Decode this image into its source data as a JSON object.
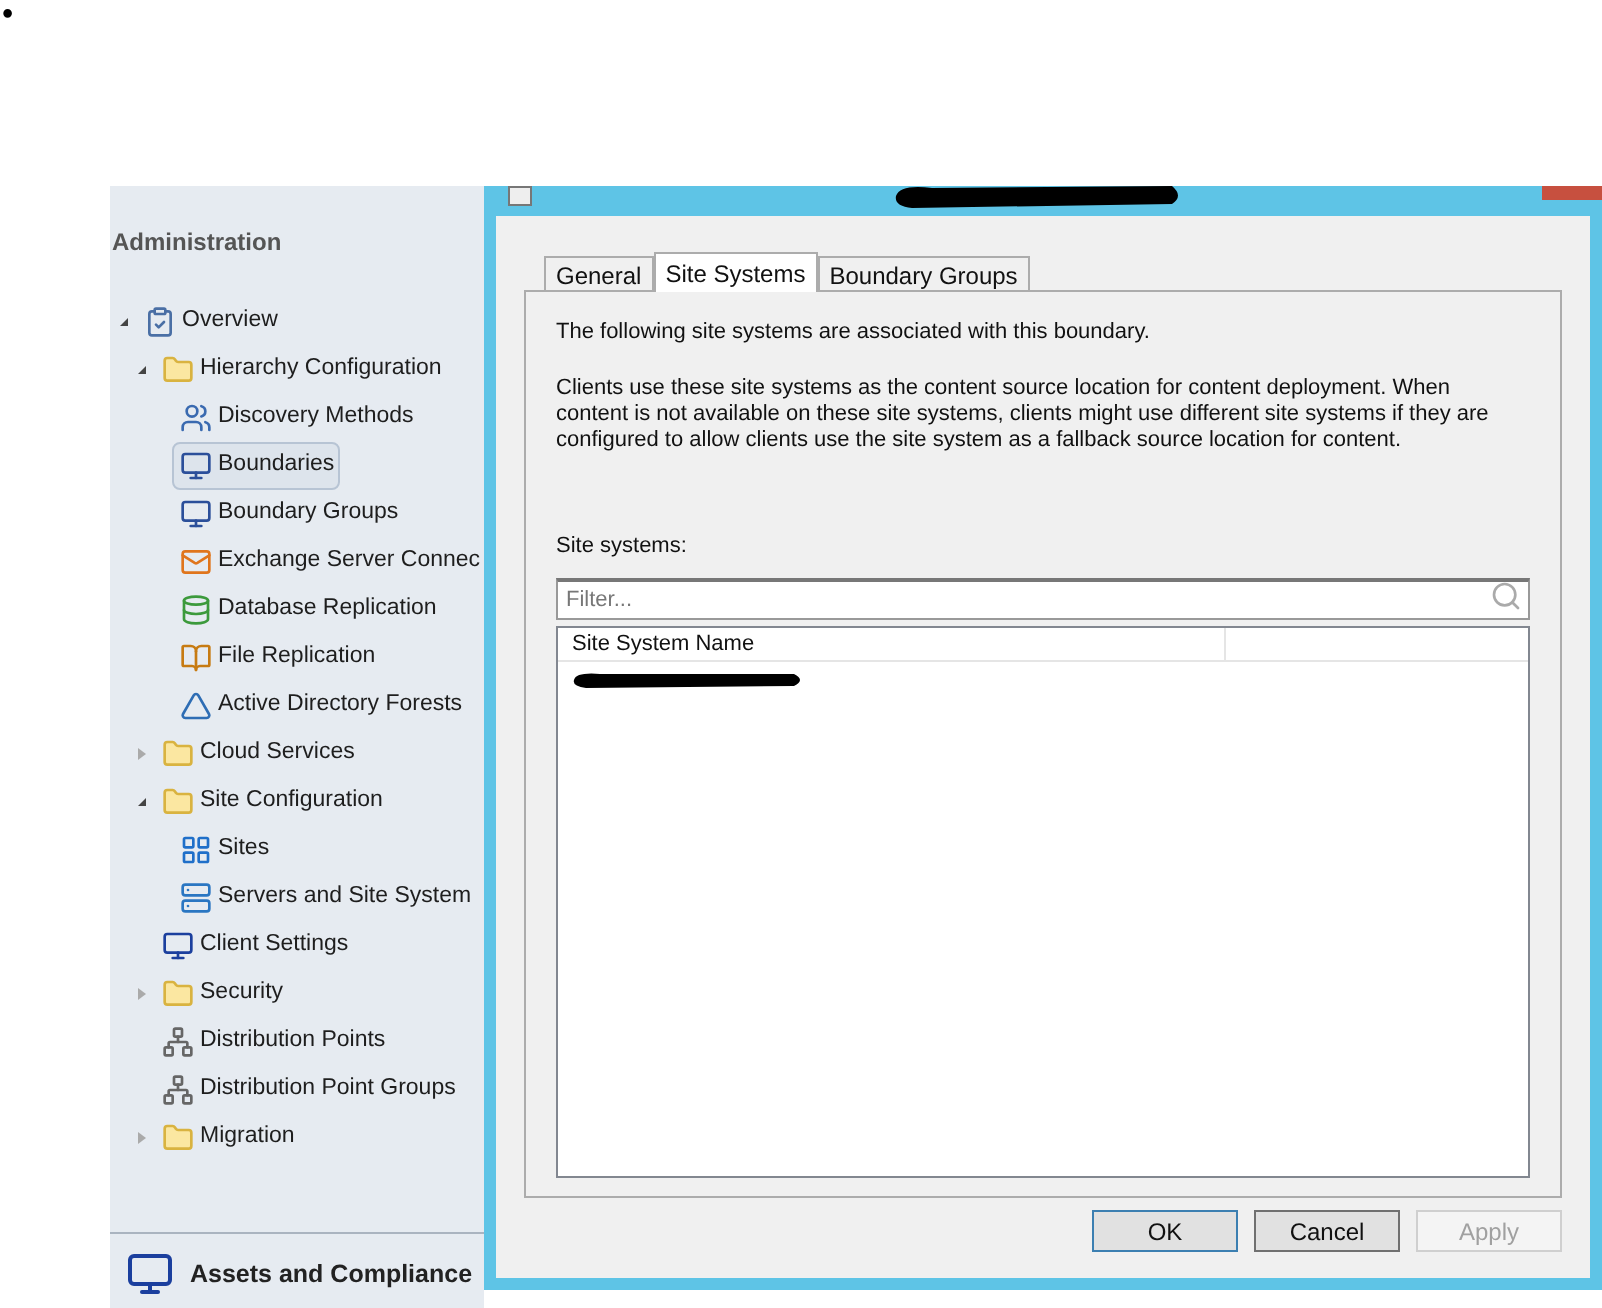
{
  "bullet": "•",
  "sidebar": {
    "title": "Administration",
    "tree": [
      {
        "label": "Overview",
        "kind": "overview",
        "expanded": true,
        "selected": false,
        "children": [
          {
            "label": "Hierarchy Configuration",
            "kind": "folder",
            "expanded": true,
            "selected": false,
            "children": [
              {
                "label": "Discovery Methods",
                "kind": "discovery",
                "selected": false
              },
              {
                "label": "Boundaries",
                "kind": "boundary",
                "selected": true
              },
              {
                "label": "Boundary Groups",
                "kind": "boundary",
                "selected": false
              },
              {
                "label": "Exchange Server Connec",
                "kind": "exchange",
                "selected": false
              },
              {
                "label": "Database Replication",
                "kind": "database",
                "selected": false
              },
              {
                "label": "File Replication",
                "kind": "file",
                "selected": false
              },
              {
                "label": "Active Directory Forests",
                "kind": "forest",
                "selected": false
              }
            ]
          },
          {
            "label": "Cloud Services",
            "kind": "folder",
            "expanded": false,
            "selected": false
          },
          {
            "label": "Site Configuration",
            "kind": "folder",
            "expanded": true,
            "selected": false,
            "children": [
              {
                "label": "Sites",
                "kind": "sites",
                "selected": false
              },
              {
                "label": "Servers and Site System",
                "kind": "servers",
                "selected": false
              }
            ]
          },
          {
            "label": "Client Settings",
            "kind": "monitor",
            "selected": false
          },
          {
            "label": "Security",
            "kind": "folder",
            "expanded": false,
            "selected": false
          },
          {
            "label": "Distribution Points",
            "kind": "distribution",
            "selected": false
          },
          {
            "label": "Distribution Point Groups",
            "kind": "distribution",
            "selected": false
          },
          {
            "label": "Migration",
            "kind": "folder",
            "expanded": false,
            "selected": false
          }
        ]
      }
    ],
    "workspace": "Assets and Compliance"
  },
  "dialog": {
    "tabs": [
      {
        "label": "General",
        "selected": false
      },
      {
        "label": "Site Systems",
        "selected": true
      },
      {
        "label": "Boundary Groups",
        "selected": false
      }
    ],
    "intro": "The following site systems are associated with this boundary.",
    "description": "Clients use these site systems as the content source location for content deployment. When content is not available on these site systems, clients might use different site systems if they are  configured to allow clients use the site system as a fallback source location for content.",
    "list_label": "Site systems:",
    "filter": {
      "placeholder": "Filter..."
    },
    "columns": [
      "Site System Name"
    ],
    "buttons": [
      {
        "label": "OK",
        "disabled": false,
        "default": true
      },
      {
        "label": "Cancel",
        "disabled": false,
        "default": false
      },
      {
        "label": "Apply",
        "disabled": true,
        "default": false
      }
    ]
  }
}
